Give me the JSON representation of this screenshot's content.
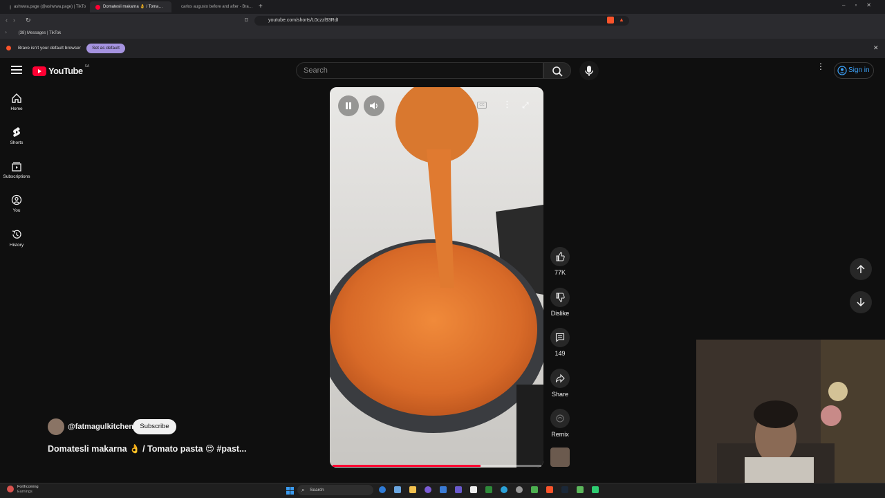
{
  "browser": {
    "tabs": [
      {
        "label": "ashwwa.page (@ashwwa.page) | TikTok",
        "active": false
      },
      {
        "label": "Domatesli makarna 👌 / Toma…",
        "active": true
      },
      {
        "label": "carlos augusto before and after - Bra…",
        "active": false
      }
    ],
    "url": "youtube.com/shorts/L0czzl93RdI",
    "bookmark": "(38) Messages | TikTok",
    "infobar_text": "Brave isn't your default browser",
    "infobar_button": "Set as default"
  },
  "youtube": {
    "logo_text": "YouTube",
    "logo_region": "SA",
    "search_placeholder": "Search",
    "sign_in": "Sign in",
    "nav": [
      {
        "label": "Home",
        "icon": "home-icon"
      },
      {
        "label": "Shorts",
        "icon": "shorts-icon"
      },
      {
        "label": "Subscriptions",
        "icon": "subscriptions-icon"
      },
      {
        "label": "You",
        "icon": "you-icon"
      },
      {
        "label": "History",
        "icon": "history-icon"
      }
    ],
    "short": {
      "channel": "@fatmagulkitchen",
      "subscribe": "Subscribe",
      "title": "Domatesli makarna 👌 / Tomato pasta 😍 #past...",
      "progress": 0.71,
      "likes": "77K",
      "dislike": "Dislike",
      "comments": "149",
      "share": "Share",
      "remix": "Remix"
    }
  },
  "taskbar": {
    "weather_line1": "Forthcoming",
    "weather_line2": "Earnings",
    "search": "Search"
  }
}
